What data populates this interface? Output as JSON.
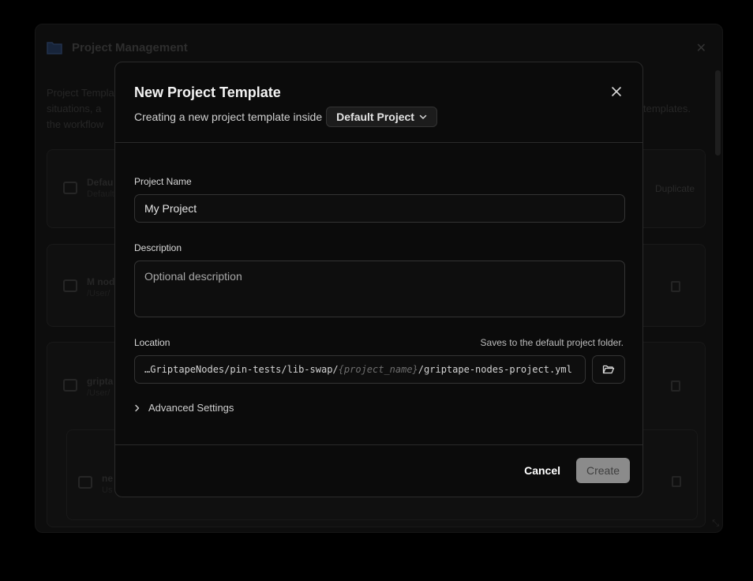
{
  "background": {
    "title": "Project Management",
    "description_line1": "Project Templat",
    "description_line2": "situations, a",
    "description_line3": "the workflow",
    "description_right": "templates.",
    "cards": [
      {
        "title": "Defau",
        "sub": "Default",
        "action": "Duplicate"
      },
      {
        "title": "M nod",
        "sub": "/User/"
      },
      {
        "title": "gripta",
        "sub": "/User/"
      },
      {
        "title": "ne",
        "sub": "Us"
      }
    ]
  },
  "dialog": {
    "title": "New Project Template",
    "subtitle": "Creating a new project template inside",
    "project_select": "Default Project",
    "project_name": {
      "label": "Project Name",
      "value": "My Project"
    },
    "description": {
      "label": "Description",
      "placeholder": "Optional description"
    },
    "location": {
      "label": "Location",
      "hint": "Saves to the default project folder.",
      "path_prefix": "…GriptapeNodes/pin-tests/lib-swap/",
      "path_variable": "{project_name}",
      "path_suffix": "/griptape-nodes-project.yml"
    },
    "advanced_label": "Advanced Settings",
    "cancel_label": "Cancel",
    "create_label": "Create"
  },
  "icons": {
    "close": "close-icon",
    "chevron_down": "chevron-down-icon",
    "folder_open": "folder-open-icon",
    "chevron_right": "chevron-right-icon"
  },
  "colors": {
    "dialog_background": "#0b0b0b",
    "border": "#2b2b2b",
    "primary_disabled": "#8b8b8b"
  }
}
